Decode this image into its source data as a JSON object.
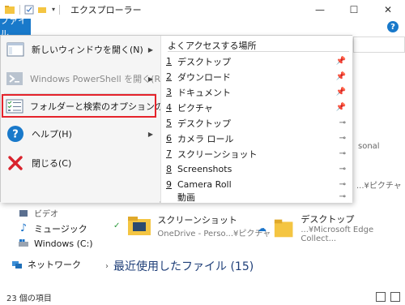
{
  "window": {
    "title": "エクスプローラー",
    "minimize": "—",
    "maximize": "☐",
    "close": "✕"
  },
  "ribbon": {
    "file_tab": "ファイル",
    "help": "?"
  },
  "file_menu": {
    "items": [
      {
        "label": "新しいウィンドウを開く(N)",
        "icon": "new-window-icon",
        "submenu": true,
        "enabled": true
      },
      {
        "label": "Windows PowerShell を開く(R)",
        "icon": "powershell-icon",
        "submenu": true,
        "enabled": false
      },
      {
        "label": "フォルダーと検索のオプションの変更(O)",
        "icon": "folder-options-icon",
        "submenu": false,
        "enabled": true,
        "highlighted": true
      },
      {
        "label": "ヘルプ(H)",
        "icon": "help-icon",
        "submenu": true,
        "enabled": true
      },
      {
        "label": "閉じる(C)",
        "icon": "close-x-icon",
        "submenu": false,
        "enabled": true
      }
    ],
    "frequent": {
      "title": "よくアクセスする場所",
      "items": [
        {
          "num": "1",
          "label": "デスクトップ",
          "pin": "pinned"
        },
        {
          "num": "2",
          "label": "ダウンロード",
          "pin": "pinned"
        },
        {
          "num": "3",
          "label": "ドキュメント",
          "pin": "pinned"
        },
        {
          "num": "4",
          "label": "ピクチャ",
          "pin": "pinned"
        },
        {
          "num": "5",
          "label": "デスクトップ",
          "pin": "unpinned"
        },
        {
          "num": "6",
          "label": "カメラ ロール",
          "pin": "unpinned"
        },
        {
          "num": "7",
          "label": "スクリーンショット",
          "pin": "unpinned"
        },
        {
          "num": "8",
          "label": "Screenshots",
          "pin": "unpinned"
        },
        {
          "num": "9",
          "label": "Camera Roll",
          "pin": "unpinned"
        },
        {
          "num": "",
          "label": "動画",
          "pin": "unpinned"
        }
      ]
    }
  },
  "background": {
    "right_frag_1": "sonal",
    "right_frag_2": "...¥ピクチャ",
    "nav": {
      "video": "ビデオ",
      "music": "ミュージック",
      "windows_c": "Windows (C:)",
      "network": "ネットワーク"
    },
    "tiles": [
      {
        "name": "スクリーンショット",
        "sub": "OneDrive - Perso...¥ピクチャ"
      },
      {
        "name": "デスクトップ",
        "sub": "...¥Microsoft Edge Collect..."
      }
    ],
    "recent_header": "最近使用したファイル (15)",
    "status": "23 個の項目"
  },
  "colors": {
    "accent": "#1979ca",
    "highlight_border": "#e5232b",
    "folder_yellow": "#f4c542",
    "check_green": "#2e9b3f",
    "cloud_blue": "#1a73c9"
  }
}
